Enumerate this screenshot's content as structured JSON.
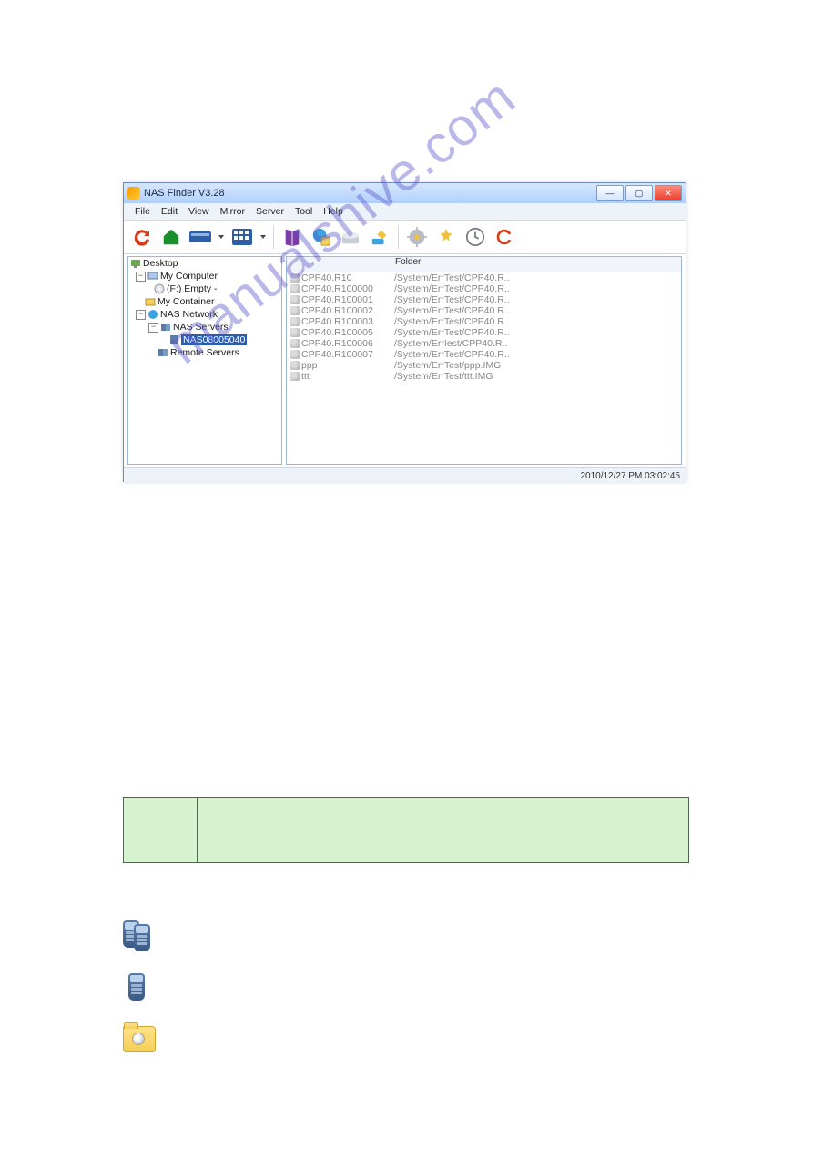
{
  "window": {
    "title": "NAS Finder V3.28"
  },
  "menus": {
    "file": "File",
    "edit": "Edit",
    "view": "View",
    "mirror": "Mirror",
    "server": "Server",
    "tool": "Tool",
    "help": "Help"
  },
  "tree": {
    "root": "Desktop",
    "my_computer": "My Computer",
    "drive": "(F:) Empty -",
    "my_container": "My Container",
    "nas_network": "NAS Network",
    "nas_servers": "NAS Servers",
    "selected_server": "NAS08005040",
    "remote_servers": "Remote Servers"
  },
  "list": {
    "col1": "",
    "col2": "Folder",
    "rows": [
      {
        "name": "CPP40.R10",
        "folder": "/System/ErrTest/CPP40.R.."
      },
      {
        "name": "CPP40.R100000",
        "folder": "/System/ErrTest/CPP40.R.."
      },
      {
        "name": "CPP40.R100001",
        "folder": "/System/ErrTest/CPP40.R.."
      },
      {
        "name": "CPP40.R100002",
        "folder": "/System/ErrTest/CPP40.R.."
      },
      {
        "name": "CPP40.R100003",
        "folder": "/System/ErrTest/CPP40.R.."
      },
      {
        "name": "CPP40.R100005",
        "folder": "/System/ErrTest/CPP40.R.."
      },
      {
        "name": "CPP40.R100006",
        "folder": "/System/ErrIest/CPP40.R.."
      },
      {
        "name": "CPP40.R100007",
        "folder": "/System/ErrTest/CPP40.R.."
      },
      {
        "name": "ppp",
        "folder": "/System/ErrTest/ppp.IMG"
      },
      {
        "name": "ttt",
        "folder": "/System/ErrTest/ttt.IMG"
      }
    ]
  },
  "status": {
    "datetime": "2010/12/27  PM 03:02:45"
  },
  "watermark": "manualshive.com"
}
